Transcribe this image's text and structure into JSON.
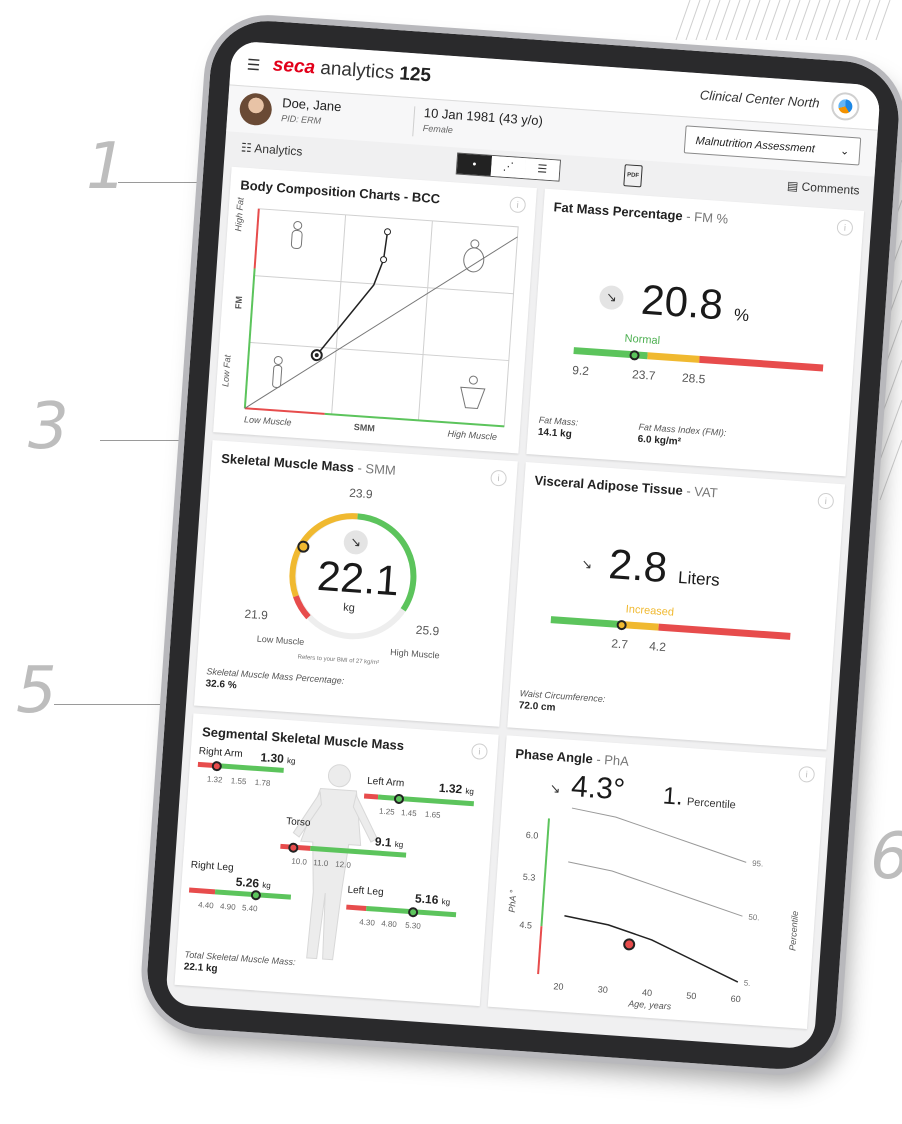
{
  "callouts": [
    "1",
    "3",
    "5",
    "6"
  ],
  "app": {
    "brand_seca": "seca",
    "brand_rest": "analytics",
    "brand_num": "125",
    "center": "Clinical Center North"
  },
  "patient": {
    "name": "Doe, Jane",
    "pid": "PID: ERM",
    "dob": "10 Jan 1981 (43 y/o)",
    "sex": "Female",
    "assessment": "Malnutrition Assessment"
  },
  "toolbar": {
    "analytics": "Analytics",
    "pdf": "PDF",
    "comments": "Comments"
  },
  "bcc": {
    "title": "Body Composition Charts - BCC",
    "y_high": "High Fat",
    "y_mid": "FM",
    "y_low": "Low Fat",
    "x_low": "Low Muscle",
    "x_mid": "SMM",
    "x_high": "High Muscle"
  },
  "fm": {
    "title": "Fat Mass Percentage",
    "subtitle": "- FM %",
    "value": "20.8",
    "unit": "%",
    "status": "Normal",
    "ticks": [
      "9.2",
      "23.7",
      "28.5"
    ],
    "fat_mass_label": "Fat Mass:",
    "fat_mass_value": "14.1 kg",
    "fmi_label": "Fat Mass Index (FMI):",
    "fmi_value": "6.0 kg/m²"
  },
  "smm": {
    "title": "Skeletal Muscle Mass",
    "subtitle": "- SMM",
    "value": "22.1",
    "unit": "kg",
    "top": "23.9",
    "left": "21.9",
    "right": "25.9",
    "low_label": "Low Muscle",
    "high_label": "High Muscle",
    "note": "Refers to your BMI of 27 kg/m²",
    "pct_label": "Skeletal Muscle Mass Percentage:",
    "pct_value": "32.6 %"
  },
  "vat": {
    "title": "Visceral Adipose Tissue",
    "subtitle": "- VAT",
    "value": "2.8",
    "unit": "Liters",
    "status": "Increased",
    "ticks": [
      "2.7",
      "4.2"
    ],
    "waist_label": "Waist Circumference:",
    "waist_value": "72.0 cm"
  },
  "seg": {
    "title": "Segmental Skeletal Muscle Mass",
    "right_arm": {
      "label": "Right Arm",
      "value": "1.30",
      "unit": "kg",
      "ticks": [
        "1.32",
        "1.55",
        "1.78"
      ]
    },
    "left_arm": {
      "label": "Left Arm",
      "value": "1.32",
      "unit": "kg",
      "ticks": [
        "1.25",
        "1.45",
        "1.65"
      ]
    },
    "torso": {
      "label": "Torso",
      "value": "9.1",
      "unit": "kg",
      "ticks": [
        "10.0",
        "11.0",
        "12.0"
      ]
    },
    "right_leg": {
      "label": "Right Leg",
      "value": "5.26",
      "unit": "kg",
      "ticks": [
        "4.40",
        "4.90",
        "5.40"
      ]
    },
    "left_leg": {
      "label": "Left Leg",
      "value": "5.16",
      "unit": "kg",
      "ticks": [
        "4.30",
        "4.80",
        "5.30"
      ]
    },
    "total_label": "Total Skeletal Muscle Mass:",
    "total_value": "22.1 kg"
  },
  "pha": {
    "title": "Phase Angle",
    "subtitle": "- PhA",
    "value": "4.3",
    "unit": "°",
    "percentile": "1.",
    "percentile_label": "Percentile",
    "y_label": "PhA °",
    "x_label": "Age, years",
    "side_label": "Percentile",
    "y_ticks": [
      "6.0",
      "5.3",
      "4.5"
    ],
    "x_ticks": [
      "20",
      "30",
      "40",
      "50",
      "60"
    ],
    "curve_labels": [
      "95.",
      "50.",
      "5."
    ]
  },
  "chart_data": {
    "type": "line",
    "title": "Phase Angle- PhA",
    "xlabel": "Age, years",
    "ylabel": "PhA °",
    "x": [
      20,
      30,
      40,
      50,
      60
    ],
    "series": [
      {
        "name": "95.",
        "values": [
          6.5,
          6.4,
          6.2,
          6.0,
          5.8
        ]
      },
      {
        "name": "50.",
        "values": [
          5.6,
          5.5,
          5.3,
          5.1,
          4.9
        ]
      },
      {
        "name": "5.",
        "values": [
          4.7,
          4.6,
          4.4,
          4.1,
          3.8
        ]
      }
    ],
    "point": {
      "x": 35,
      "y": 4.3
    },
    "ylim": [
      3.7,
      6.3
    ]
  },
  "colors": {
    "green": "#5cc45c",
    "yellow": "#f0b930",
    "red": "#e74c4c",
    "brand_red": "#e2001a"
  }
}
